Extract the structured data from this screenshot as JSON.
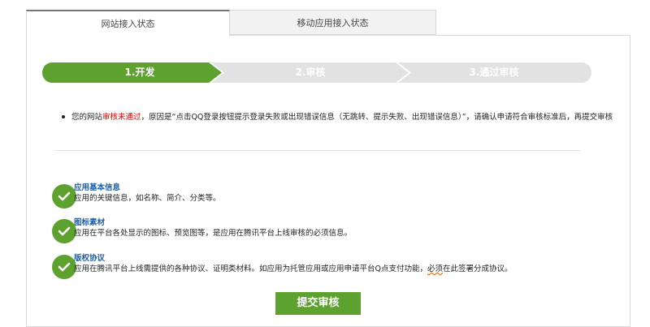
{
  "tabs": [
    {
      "label": "网站接入状态",
      "active": true
    },
    {
      "label": "移动应用接入状态",
      "active": false
    }
  ],
  "steps": [
    {
      "label": "1.开发",
      "state": "active",
      "color": "#5da12f"
    },
    {
      "label": "2.审核",
      "state": "inactive",
      "color": "#e2e2e2"
    },
    {
      "label": "3.通过审核",
      "state": "inactive",
      "color": "#e2e2e2"
    }
  ],
  "notice": {
    "prefix": "您的网站",
    "status": "审核未通过",
    "rest": "，原因是“点击QQ登录按钮提示登录失败或出现错误信息（无跳转、提示失败、出现错误信息）”，请确认申请符合审核标准后，再提交审核",
    "status_color": "#e00000"
  },
  "requirements": [
    {
      "title": "应用基本信息",
      "desc": "应用的关键信息，如名称、简介、分类等。",
      "icon": "check-icon"
    },
    {
      "title": "图标素材",
      "desc": "应用在平台各处显示的图标、预览图等，是应用在腾讯平台上线审核的必须信息。",
      "icon": "check-icon"
    },
    {
      "title": "版权协议",
      "desc_before": "应用在腾讯平台上线需提供的各种协议、证明类材料。如应用为托管应用或应用申请平台Q点支付功能，",
      "desc_mark": "必须",
      "desc_after": "在此签署分成协议。",
      "icon": "check-icon"
    }
  ],
  "submit_label": "提交审核",
  "colors": {
    "accent": "#5da12f",
    "title_blue": "#1f5fa6"
  }
}
